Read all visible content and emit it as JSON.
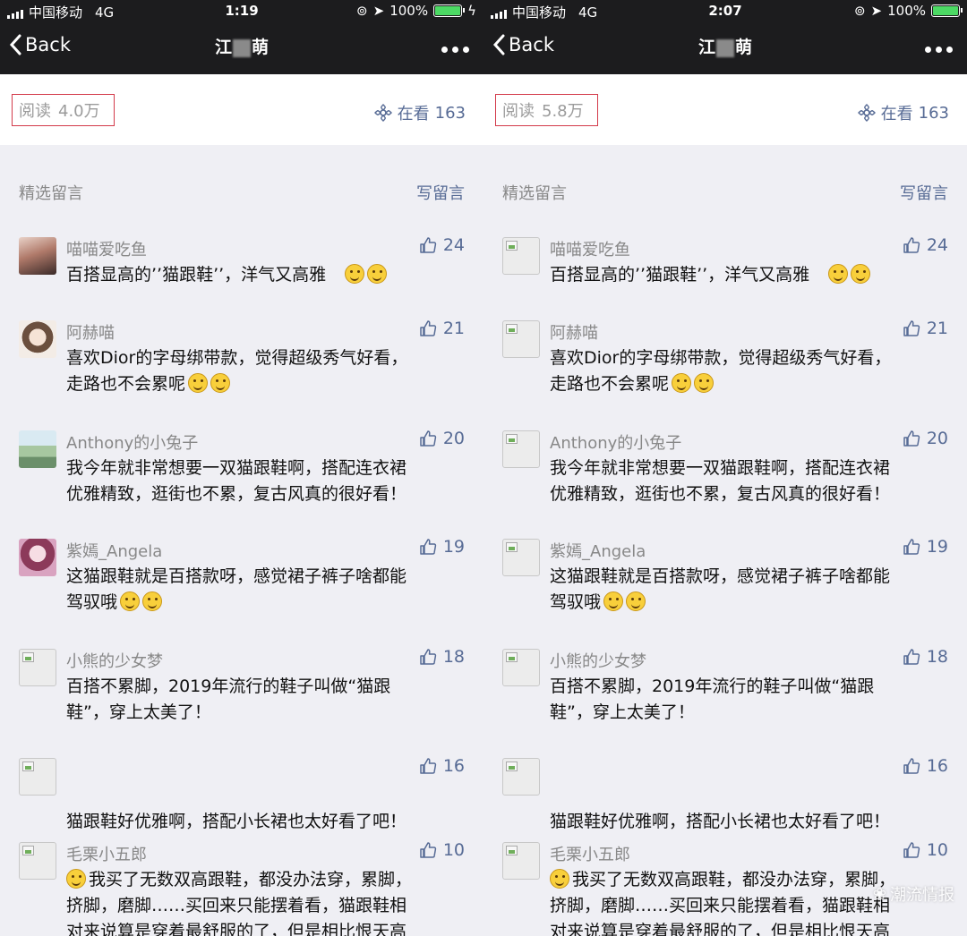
{
  "panels": [
    {
      "status": {
        "carrier": "中国移动",
        "network": "4G",
        "time": "1:19",
        "battery": "100%"
      },
      "nav": {
        "back_label": "Back",
        "title_a": "江",
        "title_b": "萌"
      },
      "read": {
        "label": "阅读",
        "count": "4.0万"
      },
      "watching": {
        "label": "在看",
        "count": "163"
      },
      "section": {
        "label": "精选留言",
        "write": "写留言"
      },
      "comments": [
        {
          "name": "喵喵爱吃鱼",
          "likes": "24",
          "text": "百搭显高的’’猫跟鞋’’，洋气又高雅",
          "emoji": 2,
          "avatar": "photo-girl"
        },
        {
          "name": "阿赫喵",
          "likes": "21",
          "text": "喜欢Dior的字母绑带款，觉得超级秀气好看，\n走路也不会累呢",
          "emoji": 2,
          "avatar": "cartoon-girl"
        },
        {
          "name": "Anthony的小兔子",
          "likes": "20",
          "text": "我今年就非常想要一双猫跟鞋啊，搭配连衣裙\n优雅精致，逛街也不累，复古风真的很好看！",
          "emoji": 0,
          "avatar": "bridge"
        },
        {
          "name": "紫嫣_Angela",
          "likes": "19",
          "text": "这猫跟鞋就是百搭款呀，感觉裙子裤子啥都能\n驾驭哦",
          "emoji": 2,
          "avatar": "anime"
        },
        {
          "name": "小熊的少女梦",
          "likes": "18",
          "text": "百搭不累脚，2019年流行的鞋子叫做“猫跟\n鞋”，穿上太美了！",
          "emoji": 0,
          "avatar": "broken"
        },
        {
          "name": "",
          "likes": "16",
          "text": "\n猫跟鞋好优雅啊，搭配小长裙也太好看了吧！",
          "emoji": 0,
          "avatar": "broken"
        },
        {
          "name": "毛栗小五郎",
          "likes": "10",
          "text": "我买了无数双高跟鞋，都没办法穿，累脚，\n挤脚，磨脚……买回来只能摆着看，猫跟鞋相\n对来说算是穿着最舒服的了，但是相比恨天高",
          "emoji": 0,
          "lead_emoji": true,
          "avatar": "broken"
        }
      ]
    },
    {
      "status": {
        "carrier": "中国移动",
        "network": "4G",
        "time": "2:07",
        "battery": "100%"
      },
      "nav": {
        "back_label": "Back",
        "title_a": "江",
        "title_b": "萌"
      },
      "read": {
        "label": "阅读",
        "count": "5.8万"
      },
      "watching": {
        "label": "在看",
        "count": "163"
      },
      "section": {
        "label": "精选留言",
        "write": "写留言"
      },
      "comments": [
        {
          "name": "喵喵爱吃鱼",
          "likes": "24",
          "text": "百搭显高的’’猫跟鞋’’，洋气又高雅",
          "emoji": 2,
          "avatar": "broken"
        },
        {
          "name": "阿赫喵",
          "likes": "21",
          "text": "喜欢Dior的字母绑带款，觉得超级秀气好看，\n走路也不会累呢",
          "emoji": 2,
          "avatar": "broken"
        },
        {
          "name": "Anthony的小兔子",
          "likes": "20",
          "text": "我今年就非常想要一双猫跟鞋啊，搭配连衣裙\n优雅精致，逛街也不累，复古风真的很好看！",
          "emoji": 0,
          "avatar": "broken"
        },
        {
          "name": "紫嫣_Angela",
          "likes": "19",
          "text": "这猫跟鞋就是百搭款呀，感觉裙子裤子啥都能\n驾驭哦",
          "emoji": 2,
          "avatar": "broken"
        },
        {
          "name": "小熊的少女梦",
          "likes": "18",
          "text": "百搭不累脚，2019年流行的鞋子叫做“猫跟\n鞋”，穿上太美了！",
          "emoji": 0,
          "avatar": "broken"
        },
        {
          "name": "",
          "likes": "16",
          "text": "\n猫跟鞋好优雅啊，搭配小长裙也太好看了吧！",
          "emoji": 0,
          "avatar": "broken"
        },
        {
          "name": "毛栗小五郎",
          "likes": "10",
          "text": "我买了无数双高跟鞋，都没办法穿，累脚，\n挤脚，磨脚……买回来只能摆着看，猫跟鞋相\n对来说算是穿着最舒服的了，但是相比恨天高",
          "emoji": 0,
          "lead_emoji": true,
          "avatar": "broken"
        }
      ],
      "watermark": "潮流情报"
    }
  ],
  "colors": {
    "link": "#576b95",
    "nav_bg": "#1c1c1e",
    "page_bg": "#efeff4",
    "highlight_border": "#d33a4a",
    "battery": "#4cd964"
  }
}
